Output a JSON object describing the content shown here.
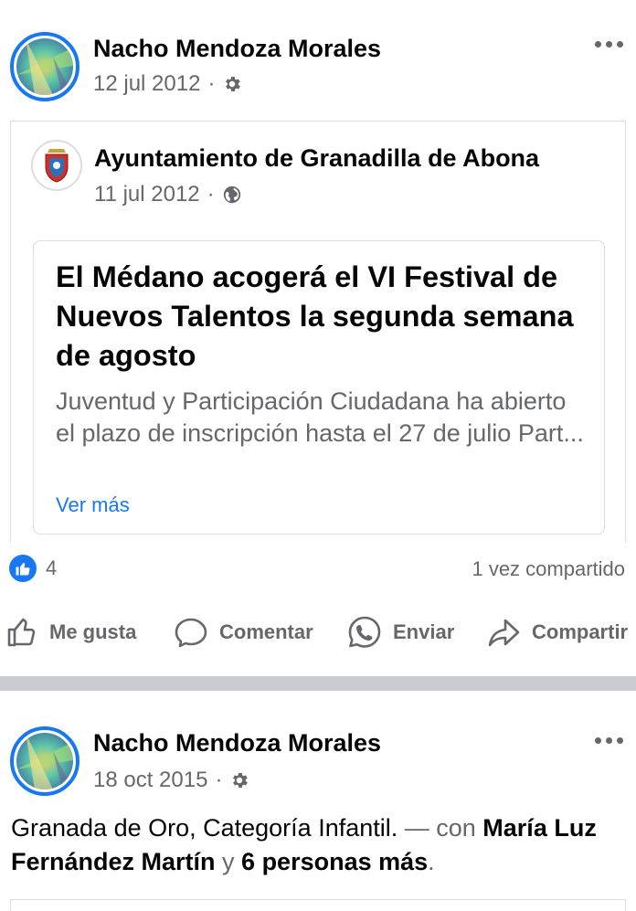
{
  "posts": [
    {
      "author": "Nacho Mendoza Morales",
      "date": "12 jul 2012",
      "separator": "·",
      "privacy_icon": "gear-icon",
      "shared": {
        "page_name": "Ayuntamiento de Granadilla de Abona",
        "date": "11 jul 2012",
        "privacy_icon": "globe-icon",
        "link": {
          "title": "El Médano acogerá el VI Festival de Nuevos Talentos la segunda semana de agosto",
          "description": "Juventud y Participación Ciudadana ha abierto el plazo de inscripción hasta el 27 de julio   Part...",
          "see_more": "Ver más"
        }
      },
      "reactions_count": "4",
      "shares": "1 vez compartido"
    },
    {
      "author": "Nacho Mendoza Morales",
      "date": "18 oct 2015",
      "separator": "·",
      "privacy_icon": "gear-icon",
      "text_plain": "Granada de Oro, Categoría Infantil.",
      "text_with": " — con ",
      "tag_person": "María Luz Fernández Martín",
      "text_and": " y ",
      "tag_others": "6 personas más",
      "text_end": "."
    }
  ],
  "actions": {
    "like": "Me gusta",
    "comment": "Comentar",
    "send": "Enviar",
    "share": "Compartir"
  },
  "colors": {
    "accent": "#1877f2",
    "secondary_text": "#65676b",
    "divider": "#c9ccd1"
  }
}
